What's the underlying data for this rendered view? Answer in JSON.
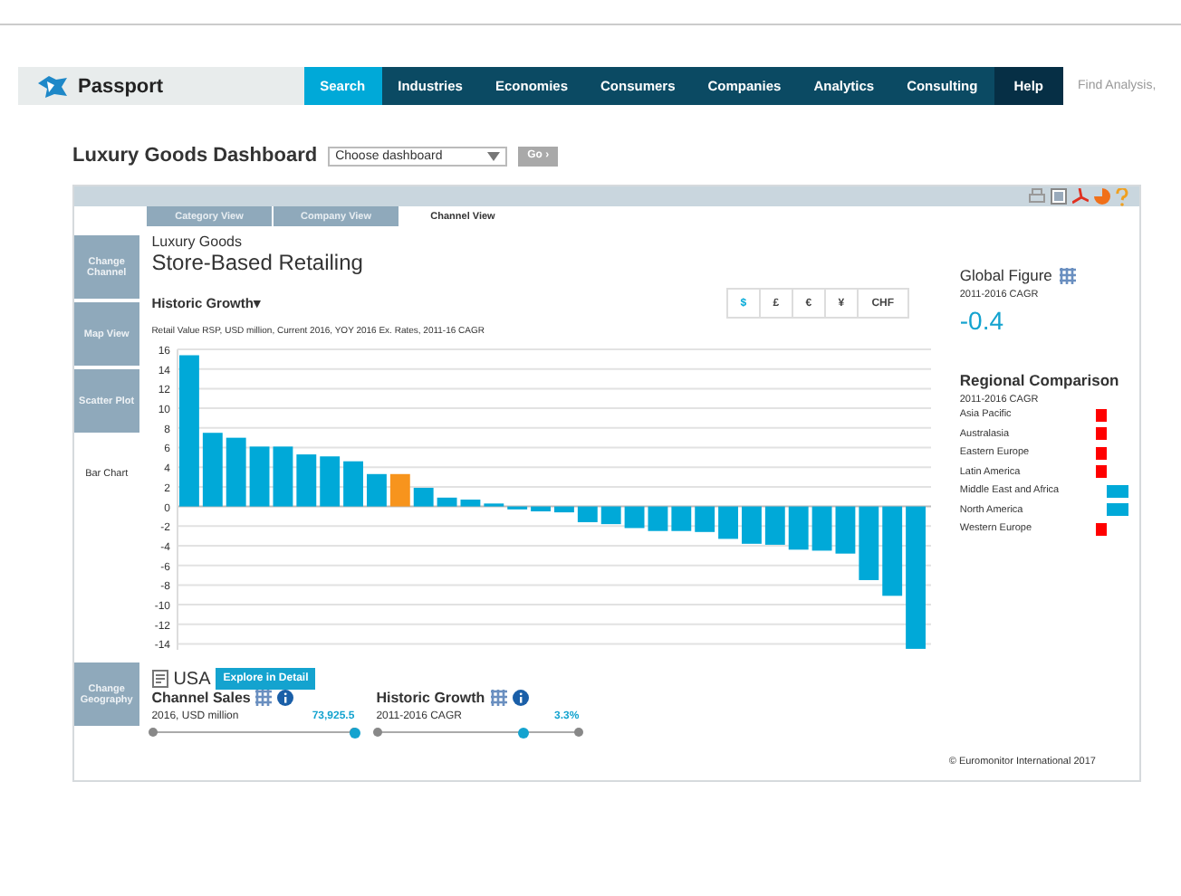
{
  "nav": {
    "logo": "Passport",
    "items": [
      {
        "label": "Search",
        "selected": true
      },
      {
        "label": "Industries",
        "selected": false
      },
      {
        "label": "Economies",
        "selected": false
      },
      {
        "label": "Consumers",
        "selected": false
      },
      {
        "label": "Companies",
        "selected": false
      },
      {
        "label": "Analytics",
        "selected": false
      },
      {
        "label": "Consulting",
        "selected": false
      }
    ],
    "help": "Help",
    "search_placeholder": "Find Analysis,"
  },
  "dashboard": {
    "title": "Luxury Goods Dashboard",
    "select": "Choose dashboard",
    "go": "Go ›"
  },
  "tabs": [
    {
      "label": "Category View",
      "selected": false
    },
    {
      "label": "Company View",
      "selected": false
    },
    {
      "label": "Channel View",
      "selected": true
    }
  ],
  "side_buttons": [
    {
      "label": "Change Channel",
      "kind": "button"
    },
    {
      "label": "Map View",
      "kind": "button"
    },
    {
      "label": "Scatter Plot",
      "kind": "button"
    },
    {
      "label": "Bar Chart",
      "kind": "current"
    }
  ],
  "geography_button": "Change Geography",
  "category": "Luxury Goods",
  "channel": "Store-Based Retailing",
  "measure": "Historic Growth",
  "measure_caret": "▾",
  "subtitle": "Retail Value RSP, USD million, Current 2016, YOY 2016 Ex. Rates, 2011-16 CAGR",
  "currencies": [
    {
      "label": "$",
      "selected": true
    },
    {
      "label": "£",
      "selected": false
    },
    {
      "label": "€",
      "selected": false
    },
    {
      "label": "¥",
      "selected": false
    },
    {
      "label": "CHF",
      "selected": false
    }
  ],
  "chart_data": {
    "type": "bar",
    "grid": true,
    "stacked": true,
    "ylim": [
      -14.6,
      16
    ],
    "yticks": [
      -14,
      -12,
      -10,
      -8,
      -6,
      -4,
      -2,
      0,
      2,
      4,
      6,
      8,
      10,
      12,
      14,
      16
    ],
    "series": [
      {
        "color": "#00a9d8",
        "values": [
          15.4,
          7.5,
          7.0,
          6.1,
          6.1,
          5.3,
          5.1,
          4.6,
          3.3,
          null,
          1.9,
          0.9,
          0.7,
          0.3,
          -0.3,
          -0.5,
          -0.6,
          -1.6,
          -1.8,
          -2.2,
          -2.5,
          -2.5,
          -2.6,
          -3.3,
          -3.8,
          -3.9,
          -4.4,
          -4.5,
          -4.8,
          -7.5,
          -9.1,
          -14.5
        ]
      },
      {
        "color": "#f7941d",
        "values": [
          null,
          null,
          null,
          null,
          null,
          null,
          null,
          null,
          null,
          3.3,
          null,
          null,
          null,
          null,
          null,
          null,
          null,
          null,
          null,
          null,
          null,
          null,
          null,
          null,
          null,
          null,
          null,
          null,
          null,
          null,
          null,
          null
        ]
      }
    ]
  },
  "global": {
    "title": "Global Figure",
    "period": "2011-2016 CAGR",
    "value": "-0.4"
  },
  "regional": {
    "title": "Regional Comparison",
    "period": "2011-2016 CAGR",
    "regions": [
      {
        "name": "Asia Pacific",
        "kind": "negative",
        "color": "#ff0000"
      },
      {
        "name": "Australasia",
        "kind": "negative",
        "color": "#ff0000"
      },
      {
        "name": "Eastern Europe",
        "kind": "negative",
        "color": "#ff0000"
      },
      {
        "name": "Latin America",
        "kind": "negative",
        "color": "#ff0000"
      },
      {
        "name": "Middle East and Africa",
        "kind": "positive",
        "color": "#00a9d8"
      },
      {
        "name": "North America",
        "kind": "positive",
        "color": "#00a9d8"
      },
      {
        "name": "Western Europe",
        "kind": "negative",
        "color": "#ff0000"
      }
    ]
  },
  "geo": {
    "name": "USA",
    "explore": "Explore in Detail"
  },
  "metrics": [
    {
      "title": "Channel Sales",
      "sub": "2016, USD million",
      "value": "73,925.5",
      "level": 1.0
    },
    {
      "title": "Historic Growth",
      "sub": "2011-2016 CAGR",
      "value": "3.3%",
      "level": 0.73
    }
  ],
  "copyright": "© Euromonitor International 2017"
}
